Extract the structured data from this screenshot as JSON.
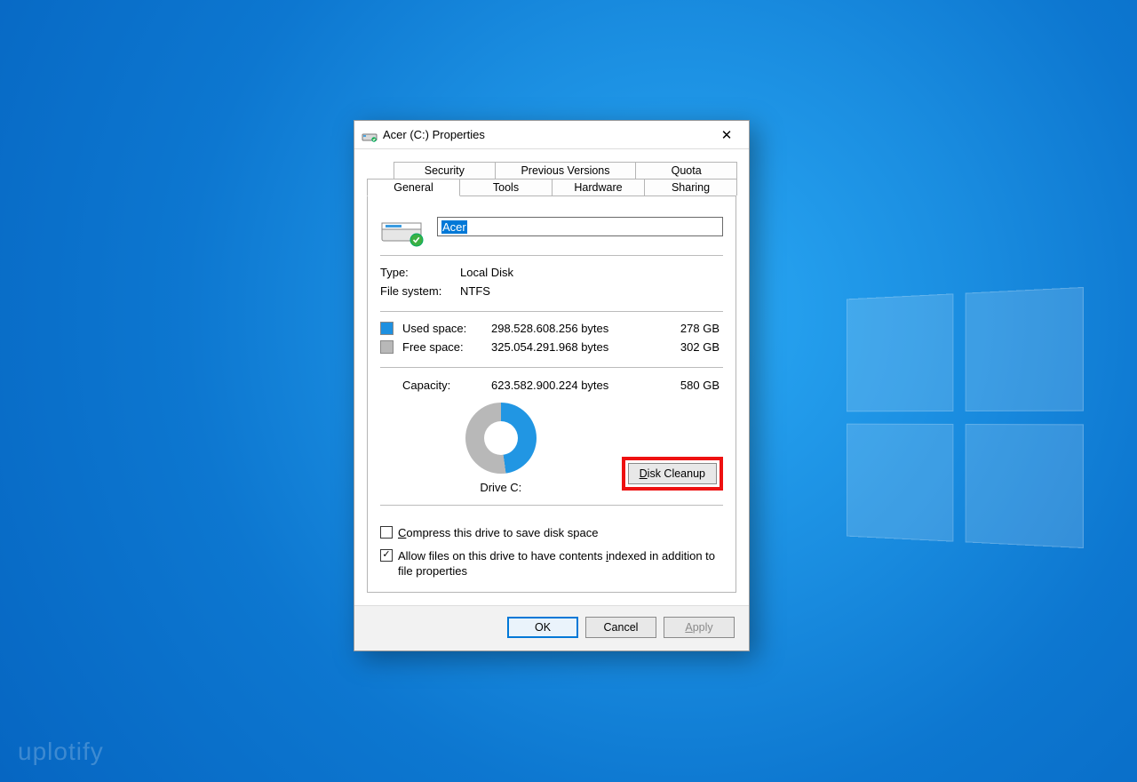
{
  "watermark": "uplotify",
  "dialog": {
    "title": "Acer (C:) Properties",
    "close_glyph": "✕",
    "tabs_top": [
      "Security",
      "Previous Versions",
      "Quota"
    ],
    "tabs_bottom": [
      "General",
      "Tools",
      "Hardware",
      "Sharing"
    ],
    "active_tab": "General",
    "name_value": "Acer",
    "type_label": "Type:",
    "type_value": "Local Disk",
    "fs_label": "File system:",
    "fs_value": "NTFS",
    "used_label": "Used space:",
    "used_bytes": "298.528.608.256 bytes",
    "used_gb": "278 GB",
    "free_label": "Free space:",
    "free_bytes": "325.054.291.968 bytes",
    "free_gb": "302 GB",
    "capacity_label": "Capacity:",
    "capacity_bytes": "623.582.900.224 bytes",
    "capacity_gb": "580 GB",
    "drive_label": "Drive C:",
    "cleanup_label": "Disk Cleanup",
    "compress_label": "Compress this drive to save disk space",
    "index_label": "Allow files on this drive to have contents indexed in addition to file properties",
    "compress_checked": false,
    "index_checked": true,
    "ok_label": "OK",
    "cancel_label": "Cancel",
    "apply_label": "Apply",
    "colors": {
      "used": "#1e90e0",
      "free": "#b8b8b8",
      "accent": "#0078d7",
      "highlight": "#e11"
    }
  }
}
